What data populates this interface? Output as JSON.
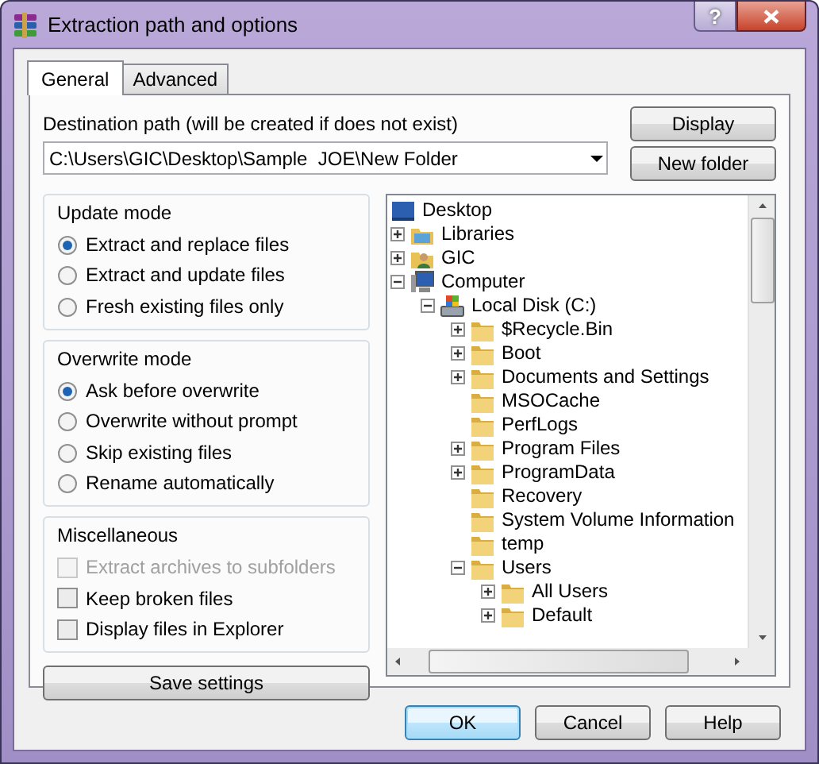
{
  "window": {
    "title": "Extraction path and options",
    "help_button": "?"
  },
  "tabs": [
    {
      "label": "General",
      "selected": true
    },
    {
      "label": "Advanced",
      "selected": false
    }
  ],
  "destination": {
    "label": "Destination path (will be created if does not exist)",
    "value": "C:\\Users\\GIC\\Desktop\\Sample  JOE\\New Folder"
  },
  "side_buttons": [
    "Display",
    "New folder"
  ],
  "update_mode": {
    "title": "Update mode",
    "options": [
      {
        "label": "Extract and replace files",
        "selected": true
      },
      {
        "label": "Extract and update files",
        "selected": false
      },
      {
        "label": "Fresh existing files only",
        "selected": false
      }
    ]
  },
  "overwrite_mode": {
    "title": "Overwrite mode",
    "options": [
      {
        "label": "Ask before overwrite",
        "selected": true
      },
      {
        "label": "Overwrite without prompt",
        "selected": false
      },
      {
        "label": "Skip existing files",
        "selected": false
      },
      {
        "label": "Rename automatically",
        "selected": false
      }
    ]
  },
  "miscellaneous": {
    "title": "Miscellaneous",
    "options": [
      {
        "label": "Extract archives to subfolders",
        "checked": false,
        "disabled": true
      },
      {
        "label": "Keep broken files",
        "checked": false,
        "disabled": false
      },
      {
        "label": "Display files in Explorer",
        "checked": false,
        "disabled": false
      }
    ]
  },
  "save_button": "Save settings",
  "folder_tree": [
    {
      "label": "Desktop",
      "kind": "desktop",
      "children": [
        {
          "label": "Libraries",
          "kind": "libraries",
          "expanded": false
        },
        {
          "label": "GIC",
          "kind": "user",
          "expanded": false
        },
        {
          "label": "Computer",
          "kind": "computer",
          "expanded": true,
          "children": [
            {
              "label": "Local Disk (C:)",
              "kind": "disk",
              "expanded": true,
              "children": [
                {
                  "label": "$Recycle.Bin",
                  "kind": "folder",
                  "expanded": false
                },
                {
                  "label": "Boot",
                  "kind": "folder",
                  "expanded": false
                },
                {
                  "label": "Documents and Settings",
                  "kind": "folder",
                  "expanded": false
                },
                {
                  "label": "MSOCache",
                  "kind": "folder"
                },
                {
                  "label": "PerfLogs",
                  "kind": "folder"
                },
                {
                  "label": "Program Files",
                  "kind": "folder",
                  "expanded": false
                },
                {
                  "label": "ProgramData",
                  "kind": "folder",
                  "expanded": false
                },
                {
                  "label": "Recovery",
                  "kind": "folder"
                },
                {
                  "label": "System Volume Information",
                  "kind": "folder"
                },
                {
                  "label": "temp",
                  "kind": "folder"
                },
                {
                  "label": "Users",
                  "kind": "folder",
                  "expanded": true,
                  "children": [
                    {
                      "label": "All Users",
                      "kind": "folder",
                      "expanded": false
                    },
                    {
                      "label": "Default",
                      "kind": "folder",
                      "expanded": false
                    }
                  ]
                }
              ]
            }
          ]
        }
      ]
    }
  ],
  "dialog_buttons": [
    {
      "label": "OK",
      "default": true
    },
    {
      "label": "Cancel",
      "default": false
    },
    {
      "label": "Help",
      "default": false
    }
  ]
}
